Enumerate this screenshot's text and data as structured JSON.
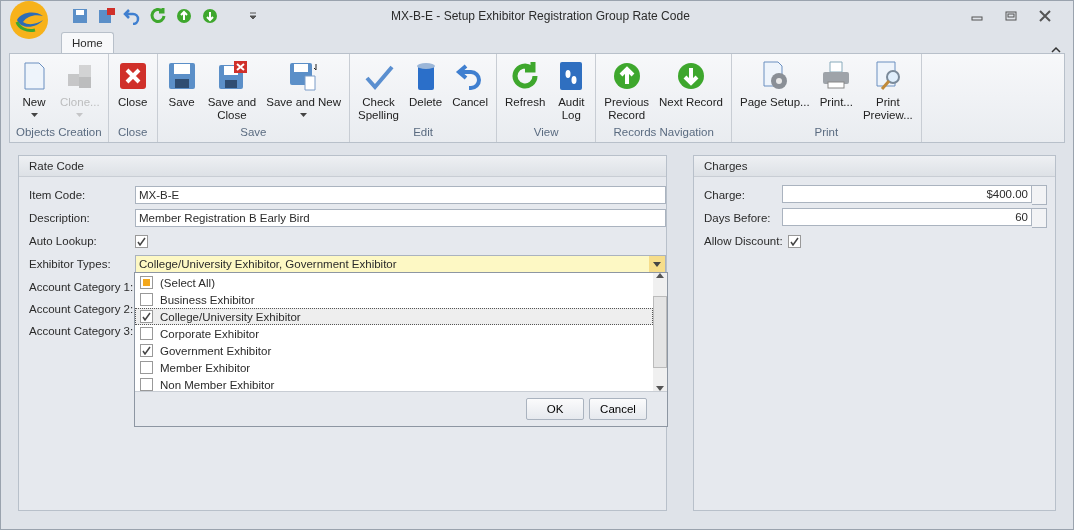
{
  "window": {
    "title": "MX-B-E - Setup Exhibitor Registration Group Rate Code"
  },
  "tabs": [
    {
      "label": "Home",
      "selected": true
    }
  ],
  "ribbon": [
    {
      "label": "Objects Creation",
      "buttons": [
        {
          "label": "New",
          "disabled": false,
          "dropdown": true
        },
        {
          "label": "Clone...",
          "disabled": true,
          "dropdown": true
        }
      ]
    },
    {
      "label": "Close",
      "buttons": [
        {
          "label": "Close",
          "disabled": false,
          "dropdown": false
        }
      ]
    },
    {
      "label": "Save",
      "buttons": [
        {
          "label": "Save",
          "disabled": false,
          "dropdown": false
        },
        {
          "label": "Save and\nClose",
          "disabled": false,
          "dropdown": false
        },
        {
          "label": "Save and New",
          "disabled": false,
          "dropdown": true
        }
      ]
    },
    {
      "label": "Edit",
      "buttons": [
        {
          "label": "Check\nSpelling",
          "disabled": false,
          "dropdown": false
        },
        {
          "label": "Delete",
          "disabled": false,
          "dropdown": false
        },
        {
          "label": "Cancel",
          "disabled": false,
          "dropdown": false
        }
      ]
    },
    {
      "label": "View",
      "buttons": [
        {
          "label": "Refresh",
          "disabled": false,
          "dropdown": false
        },
        {
          "label": "Audit\nLog",
          "disabled": false,
          "dropdown": false
        }
      ]
    },
    {
      "label": "Records Navigation",
      "buttons": [
        {
          "label": "Previous\nRecord",
          "disabled": false,
          "dropdown": false
        },
        {
          "label": "Next Record",
          "disabled": false,
          "dropdown": false
        }
      ]
    },
    {
      "label": "Print",
      "buttons": [
        {
          "label": "Page Setup...",
          "disabled": false,
          "dropdown": false
        },
        {
          "label": "Print...",
          "disabled": false,
          "dropdown": false
        },
        {
          "label": "Print\nPreview...",
          "disabled": false,
          "dropdown": false
        }
      ]
    }
  ],
  "rate_code": {
    "title": "Rate Code",
    "item_code_label": "Item Code:",
    "item_code": "MX-B-E",
    "description_label": "Description:",
    "description": "Member Registration B Early Bird",
    "auto_lookup_label": "Auto Lookup:",
    "auto_lookup": true,
    "exhibitor_types_label": "Exhibitor Types:",
    "exhibitor_types": "College/University Exhibitor, Government Exhibitor",
    "account_category_labels": [
      "Account Category 1:",
      "Account Category 2:",
      "Account Category 3:"
    ]
  },
  "dropdown": {
    "options": [
      {
        "label": "(Select All)",
        "checked": false,
        "indeterminate": true,
        "focused": false
      },
      {
        "label": "Business Exhibitor",
        "checked": false,
        "focused": false
      },
      {
        "label": "College/University Exhibitor",
        "checked": true,
        "focused": true
      },
      {
        "label": "Corporate Exhibitor",
        "checked": false,
        "focused": false
      },
      {
        "label": "Government Exhibitor",
        "checked": true,
        "focused": false
      },
      {
        "label": "Member Exhibitor",
        "checked": false,
        "focused": false
      },
      {
        "label": "Non Member Exhibitor",
        "checked": false,
        "focused": false
      }
    ],
    "buttons": [
      "OK",
      "Cancel"
    ]
  },
  "charges": {
    "title": "Charges",
    "charge_label": "Charge:",
    "charge": "$400.00",
    "days_before_label": "Days Before:",
    "days_before": "60",
    "allow_discount_label": "Allow Discount:",
    "allow_discount": true
  }
}
